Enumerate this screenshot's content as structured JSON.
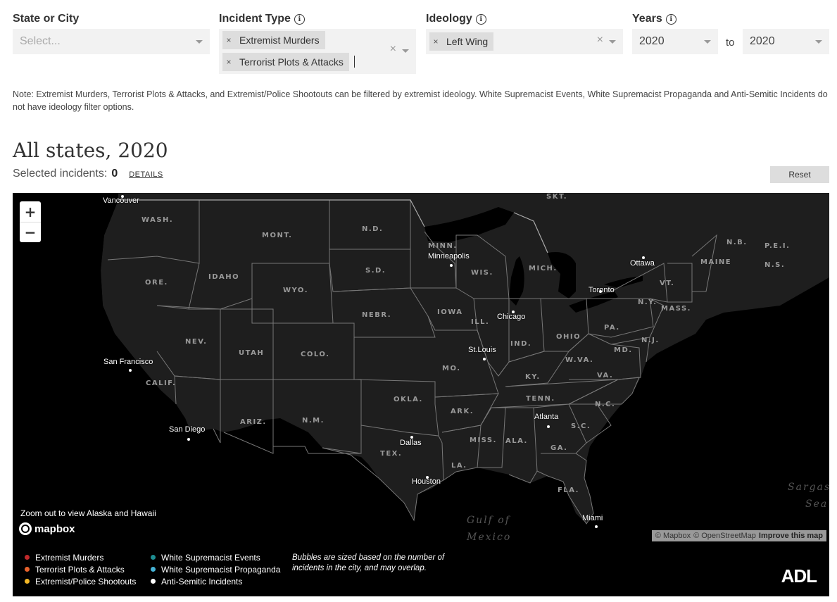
{
  "filters": {
    "state": {
      "label": "State or City",
      "placeholder": "Select..."
    },
    "incident_type": {
      "label": "Incident Type",
      "chips": [
        "Extremist Murders",
        "Terrorist Plots & Attacks"
      ]
    },
    "ideology": {
      "label": "Ideology",
      "chips": [
        "Left Wing"
      ]
    },
    "years": {
      "label": "Years",
      "from": "2020",
      "to_word": "to",
      "to": "2020"
    },
    "info_glyph": "i",
    "chip_remove_glyph": "×",
    "clear_glyph": "×"
  },
  "note": "Note: Extremist Murders, Terrorist Plots & Attacks, and Extremist/Police Shootouts can be filtered by extremist ideology. White Supremacist Events, White Supremacist Propaganda and Anti-Semitic Incidents do not have ideology filter options.",
  "region_title": "All states, 2020",
  "selected": {
    "label": "Selected incidents:",
    "count": "0",
    "details_link": "DETAILS"
  },
  "reset_label": "Reset",
  "map": {
    "zoom_in": "+",
    "zoom_out": "−",
    "zoom_note": "Zoom out to view Alaska and Hawaii",
    "mapbox_label": "mapbox",
    "attribution": {
      "mapbox": "© Mapbox",
      "osm": "© OpenStreetMap",
      "improve": "Improve this map"
    },
    "state_labels": [
      "WASH.",
      "ORE.",
      "IDAHO",
      "MONT.",
      "WYO.",
      "N.D.",
      "S.D.",
      "NEBR.",
      "NEV.",
      "UTAH",
      "COLO.",
      "CALIF.",
      "ARIZ.",
      "N.M.",
      "TEX.",
      "OKLA.",
      "MINN.",
      "IOWA",
      "MO.",
      "ARK.",
      "LA.",
      "WIS.",
      "ILL.",
      "MICH.",
      "IND.",
      "OHIO",
      "KY.",
      "TENN.",
      "MISS.",
      "ALA.",
      "GA.",
      "FLA.",
      "S.C.",
      "N.C.",
      "VA.",
      "W.VA.",
      "PA.",
      "N.Y.",
      "MD.",
      "N.J.",
      "VT.",
      "MASS.",
      "MAINE",
      "N.B.",
      "P.E.I.",
      "N.S.",
      "SKT."
    ],
    "cities": [
      "Vancouver",
      "Minneapolis",
      "Ottawa",
      "Toronto",
      "Chicago",
      "St.Louis",
      "San Francisco",
      "San Diego",
      "Dallas",
      "Houston",
      "Atlanta",
      "Miami"
    ],
    "water_labels": [
      "Gulf of",
      "Mexico",
      "Sargas",
      "Sea"
    ]
  },
  "legend": {
    "items": [
      {
        "label": "Extremist Murders",
        "color": "#c0292b"
      },
      {
        "label": "Terrorist Plots & Attacks",
        "color": "#e8622c"
      },
      {
        "label": "Extremist/Police Shootouts",
        "color": "#f4b826"
      },
      {
        "label": "White Supremacist Events",
        "color": "#1e8e92"
      },
      {
        "label": "White Supremacist Propaganda",
        "color": "#45b3d6"
      },
      {
        "label": "Anti-Semitic Incidents",
        "color": "#ffffff"
      }
    ],
    "note": "Bubbles are sized based on the number of incidents in the city, and may overlap.",
    "logo": "ADL"
  }
}
